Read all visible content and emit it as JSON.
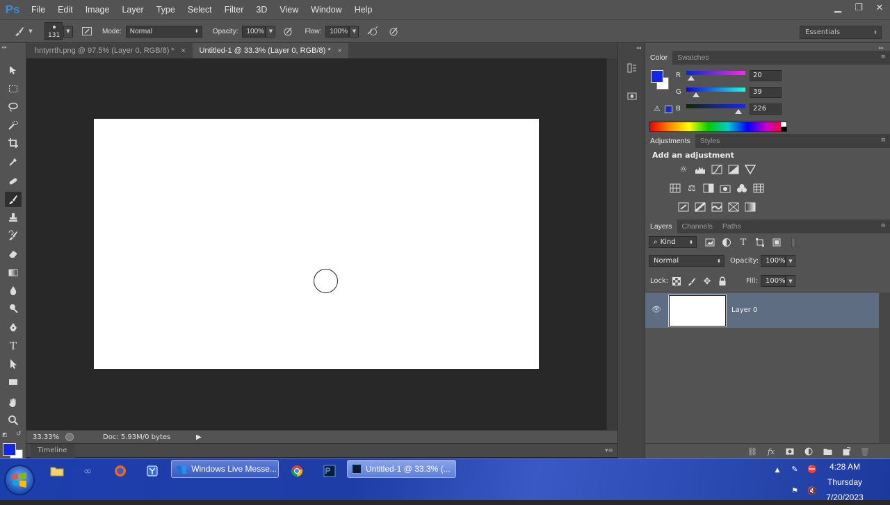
{
  "app": {
    "logo": "Ps"
  },
  "menu": [
    "File",
    "Edit",
    "Image",
    "Layer",
    "Type",
    "Select",
    "Filter",
    "3D",
    "View",
    "Window",
    "Help"
  ],
  "window_controls": {
    "minimize": "▁",
    "maximize": "❐",
    "close": "✕"
  },
  "options": {
    "brush_size": "131",
    "mode_label": "Mode:",
    "mode_value": "Normal",
    "opacity_label": "Opacity:",
    "opacity_value": "100%",
    "flow_label": "Flow:",
    "flow_value": "100%",
    "workspace": "Essentials"
  },
  "tabs": [
    {
      "label": "hntyrrth.png @ 97.5% (Layer 0, RGB/8) *",
      "close": "×"
    },
    {
      "label": "Untitled-1 @ 33.3% (Layer 0, RGB/8) *",
      "close": "×"
    }
  ],
  "status": {
    "zoom": "33.33%",
    "doc": "Doc: 5.93M/0 bytes"
  },
  "timeline": {
    "label": "Timeline"
  },
  "color_panel": {
    "tabs": [
      "Color",
      "Swatches"
    ],
    "foreground": "#1427e2",
    "r_label": "R",
    "g_label": "G",
    "b_label": "B",
    "r": "20",
    "g": "39",
    "b": "226"
  },
  "adjustments_panel": {
    "tabs": [
      "Adjustments",
      "Styles"
    ],
    "heading": "Add an adjustment"
  },
  "layers_panel": {
    "tabs": [
      "Layers",
      "Channels",
      "Paths"
    ],
    "filter_kind": "Kind",
    "blend_mode": "Normal",
    "opacity_label": "Opacity:",
    "opacity_value": "100%",
    "lock_label": "Lock:",
    "fill_label": "Fill:",
    "fill_value": "100%",
    "layer_name": "Layer 0"
  },
  "taskbar": {
    "tasks": [
      {
        "label": "Windows Live Messe..."
      },
      {
        "label": "Untitled-1 @ 33.3% (..."
      }
    ],
    "clock": {
      "time": "4:28 AM",
      "day": "Thursday",
      "date": "7/20/2023"
    }
  }
}
